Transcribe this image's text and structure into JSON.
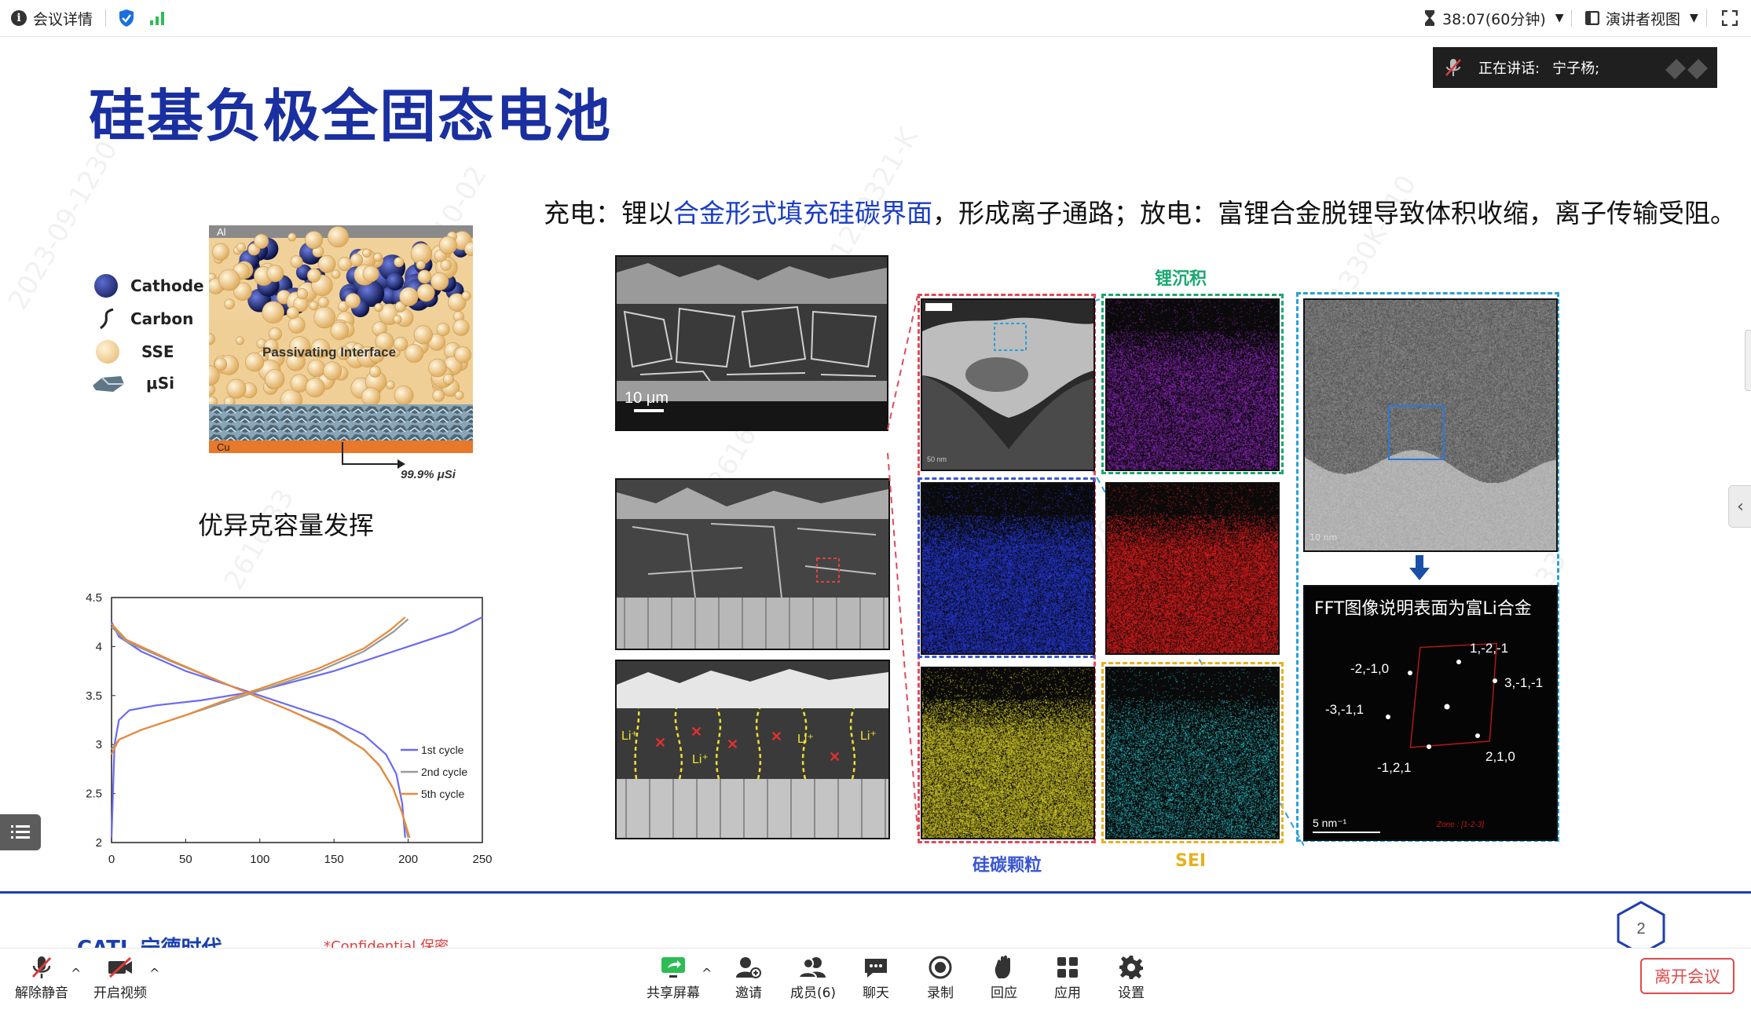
{
  "topbar": {
    "meeting_details": "会议详情",
    "timer": "38:07(60分钟)",
    "view_mode": "演讲者视图"
  },
  "speaker": {
    "label": "正在讲话:",
    "name": "宁子杨;"
  },
  "slide": {
    "title": "硅基负极全固态电池",
    "subtitle_pre": "充电：锂以",
    "subtitle_hl": "合金形式填充硅碳界面",
    "subtitle_post": "，形成离子通路；放电：富锂合金脱锂导致体积收缩，离子传输受阻。",
    "schematic": {
      "legend": [
        "Cathode",
        "Carbon",
        "SSE",
        "μSi"
      ],
      "top_label": "Al",
      "bottom_label": "Cu",
      "interface_label": "Passivating Interface",
      "pointer_label": "99.9% μSi"
    },
    "chart_title": "优异克容量发挥",
    "sem": {
      "scale_label": "10 μm",
      "li_label": "Li⁺"
    },
    "eds": {
      "li_deposit_label": "锂沉积",
      "si_c_label": "硅碳颗粒",
      "sei_label": "SEI",
      "scale": "50 nm",
      "tem_scale": "10 nm"
    },
    "fft": {
      "caption": "FFT图像说明表面为富Li合金",
      "points": [
        "1,-2,-1",
        "-2,-1,0",
        "3,-1,-1",
        "-3,-1,1",
        "2,1,0",
        "-1,2,1"
      ],
      "scale": "5 nm⁻¹",
      "zone": "Zone : [1-2-3]"
    },
    "footer_company": "CATL 宁德时代",
    "footer_confidential": "*Confidential 保密",
    "page_number": "2"
  },
  "chart_data": {
    "type": "line",
    "title": "",
    "xlabel": "",
    "ylabel": "",
    "xlim": [
      0,
      250
    ],
    "ylim": [
      2,
      4.5
    ],
    "x_ticks": [
      "0",
      "50",
      "100",
      "150",
      "200",
      "250"
    ],
    "y_ticks": [
      "2",
      "2.5",
      "3",
      "3.5",
      "4",
      "4.5"
    ],
    "legend_position": "bottom-right",
    "series": [
      {
        "name": "1st cycle",
        "color": "#6a6af0",
        "charge": [
          [
            0,
            2.05
          ],
          [
            2,
            3.0
          ],
          [
            5,
            3.25
          ],
          [
            12,
            3.35
          ],
          [
            30,
            3.4
          ],
          [
            60,
            3.45
          ],
          [
            100,
            3.55
          ],
          [
            150,
            3.75
          ],
          [
            200,
            4.0
          ],
          [
            230,
            4.15
          ],
          [
            250,
            4.3
          ]
        ],
        "discharge": [
          [
            0,
            4.25
          ],
          [
            5,
            4.1
          ],
          [
            20,
            3.95
          ],
          [
            50,
            3.75
          ],
          [
            100,
            3.5
          ],
          [
            150,
            3.25
          ],
          [
            170,
            3.1
          ],
          [
            185,
            2.9
          ],
          [
            192,
            2.7
          ],
          [
            196,
            2.4
          ],
          [
            198,
            2.05
          ]
        ]
      },
      {
        "name": "2nd cycle",
        "color": "#9a9a9a",
        "charge": [
          [
            0,
            2.95
          ],
          [
            5,
            3.05
          ],
          [
            20,
            3.15
          ],
          [
            50,
            3.3
          ],
          [
            80,
            3.45
          ],
          [
            100,
            3.55
          ],
          [
            140,
            3.75
          ],
          [
            170,
            3.95
          ],
          [
            190,
            4.15
          ],
          [
            200,
            4.28
          ]
        ],
        "discharge": [
          [
            0,
            4.2
          ],
          [
            10,
            4.05
          ],
          [
            40,
            3.85
          ],
          [
            80,
            3.6
          ],
          [
            120,
            3.35
          ],
          [
            150,
            3.15
          ],
          [
            170,
            2.95
          ],
          [
            180,
            2.8
          ],
          [
            190,
            2.55
          ],
          [
            196,
            2.3
          ],
          [
            200,
            2.05
          ]
        ]
      },
      {
        "name": "5th cycle",
        "color": "#e88a3a",
        "charge": [
          [
            0,
            2.9
          ],
          [
            5,
            3.05
          ],
          [
            20,
            3.15
          ],
          [
            50,
            3.3
          ],
          [
            80,
            3.47
          ],
          [
            100,
            3.57
          ],
          [
            140,
            3.78
          ],
          [
            170,
            3.98
          ],
          [
            188,
            4.17
          ],
          [
            198,
            4.3
          ]
        ],
        "discharge": [
          [
            0,
            4.23
          ],
          [
            10,
            4.07
          ],
          [
            40,
            3.86
          ],
          [
            80,
            3.6
          ],
          [
            120,
            3.35
          ],
          [
            150,
            3.14
          ],
          [
            170,
            2.95
          ],
          [
            181,
            2.78
          ],
          [
            190,
            2.55
          ],
          [
            196,
            2.3
          ],
          [
            201,
            2.05
          ]
        ]
      }
    ]
  },
  "toolbar": {
    "unmute": "解除静音",
    "start_video": "开启视频",
    "share_screen": "共享屏幕",
    "invite": "邀请",
    "members": "成员(6)",
    "chat": "聊天",
    "record": "录制",
    "react": "回应",
    "apps": "应用",
    "settings": "设置",
    "leave": "离开会议"
  }
}
